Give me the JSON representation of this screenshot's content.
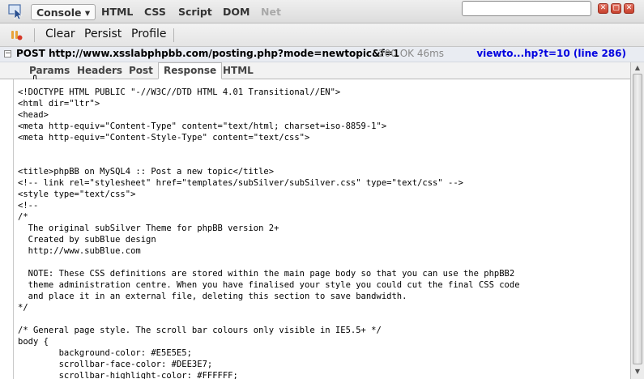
{
  "tabs": [
    "Console",
    "HTML",
    "CSS",
    "Script",
    "DOM",
    "Net"
  ],
  "console_arrow": "▾",
  "search": {
    "value": ""
  },
  "window_buttons": [
    "✕",
    "▢",
    "✕"
  ],
  "toolbar": {
    "clear": "Clear",
    "persist": "Persist",
    "profile": "Profile"
  },
  "request": {
    "toggle": "−",
    "method_url": "POST http://www.xsslabphpbb.com/posting.php?mode=newtopic&f=1",
    "status": "200 OK 46ms",
    "source_link": "viewto...hp?t=10 (line 286)"
  },
  "subtabs": [
    "Params",
    "Headers",
    "Post",
    "Response",
    "HTML"
  ],
  "response_lines": [
    "<!DOCTYPE HTML PUBLIC \"-//W3C//DTD HTML 4.01 Transitional//EN\">",
    "<html dir=\"ltr\">",
    "<head>",
    "<meta http-equiv=\"Content-Type\" content=\"text/html; charset=iso-8859-1\">",
    "<meta http-equiv=\"Content-Style-Type\" content=\"text/css\">",
    "",
    "",
    "<title>phpBB on MySQL4 :: Post a new topic</title>",
    "<!-- link rel=\"stylesheet\" href=\"templates/subSilver/subSilver.css\" type=\"text/css\" -->",
    "<style type=\"text/css\">",
    "<!--",
    "/*",
    "  The original subSilver Theme for phpBB version 2+",
    "  Created by subBlue design",
    "  http://www.subBlue.com",
    "",
    "  NOTE: These CSS definitions are stored within the main page body so that you can use the phpBB2",
    "  theme administration centre. When you have finalised your style you could cut the final CSS code",
    "  and place it in an external file, deleting this section to save bandwidth.",
    "*/",
    "",
    "/* General page style. The scroll bar colours only visible in IE5.5+ */",
    "body {",
    "        background-color: #E5E5E5;",
    "        scrollbar-face-color: #DEE3E7;",
    "        scrollbar-highlight-color: #FFFFFF;"
  ]
}
